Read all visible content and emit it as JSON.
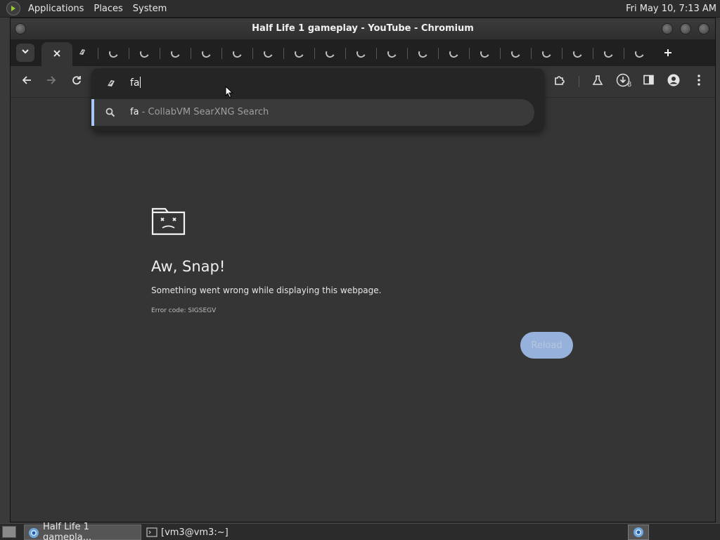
{
  "top_panel": {
    "menu": [
      "Applications",
      "Places",
      "System"
    ],
    "clock": "Fri May 10,  7:13 AM"
  },
  "window": {
    "title": "Half Life 1 gameplay - YouTube - Chromium"
  },
  "tabstrip": {
    "tab_list_icon": "chevron-down-icon",
    "close_tab_icon": "close-icon",
    "loading_tab_count": 18,
    "new_tab_icon": "plus-icon"
  },
  "toolbar": {
    "back_icon": "arrow-left-icon",
    "forward_icon": "arrow-right-icon",
    "reload_icon": "reload-icon",
    "extensions_icon": "puzzle-icon",
    "labs_icon": "flask-icon",
    "downloads_icon": "download-icon",
    "downloads_count": "8",
    "side_panel_icon": "side-panel-icon",
    "profile_icon": "profile-icon",
    "menu_icon": "kebab-menu-icon"
  },
  "omnibox": {
    "input_value": "fa",
    "suggestions": [
      {
        "query": "fa",
        "description": " - CollabVM SearXNG Search",
        "icon": "search-icon"
      }
    ]
  },
  "error_page": {
    "title": "Aw, Snap!",
    "message": "Something went wrong while displaying this webpage.",
    "error_code": "Error code: SIGSEGV",
    "reload_label": "Reload",
    "accent": "#a8c7fa"
  },
  "taskbar": {
    "tasks": [
      {
        "label": "Half Life 1 gamepla...",
        "active": true,
        "icon": "chromium-icon"
      },
      {
        "label": "[vm3@vm3:~]",
        "active": false,
        "icon": "terminal-icon"
      }
    ],
    "tray_icon": "chromium-icon"
  }
}
